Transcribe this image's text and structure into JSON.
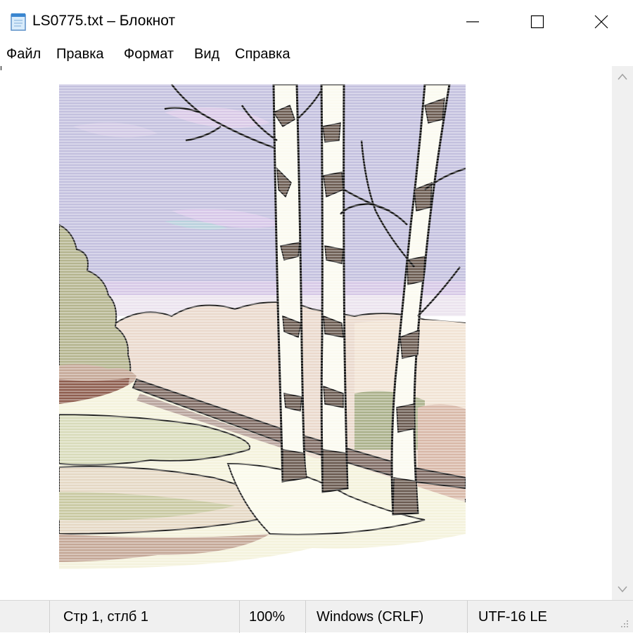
{
  "window": {
    "title": "LS0775.txt – Блокнот",
    "app_icon": "notepad-icon",
    "controls": [
      "minimize-icon",
      "maximize-icon",
      "close-icon"
    ]
  },
  "menu": {
    "items": [
      {
        "label": "Файл"
      },
      {
        "label": "Правка"
      },
      {
        "label": "Формат"
      },
      {
        "label": "Вид"
      },
      {
        "label": "Справка"
      }
    ]
  },
  "editor": {
    "content": "ASCII-art style picture of birch trees along a road (rendered as text)",
    "scrollbar": {
      "up_icon": "chevron-up-icon",
      "down_icon": "chevron-down-icon"
    }
  },
  "status": {
    "position": "Стр 1, стлб 1",
    "zoom": "100%",
    "line_endings": "Windows (CRLF)",
    "encoding": "UTF-16 LE"
  },
  "colors": {
    "sky": "#c3c0de",
    "sky_haze": "#ebe3ee",
    "hills": "#ead9cc",
    "bush": "#b4b48e",
    "bark_dark": "#6a5a50",
    "trunk": "#fbfaf0",
    "road": "#d8dbba",
    "snow": "#f4f2dc"
  }
}
